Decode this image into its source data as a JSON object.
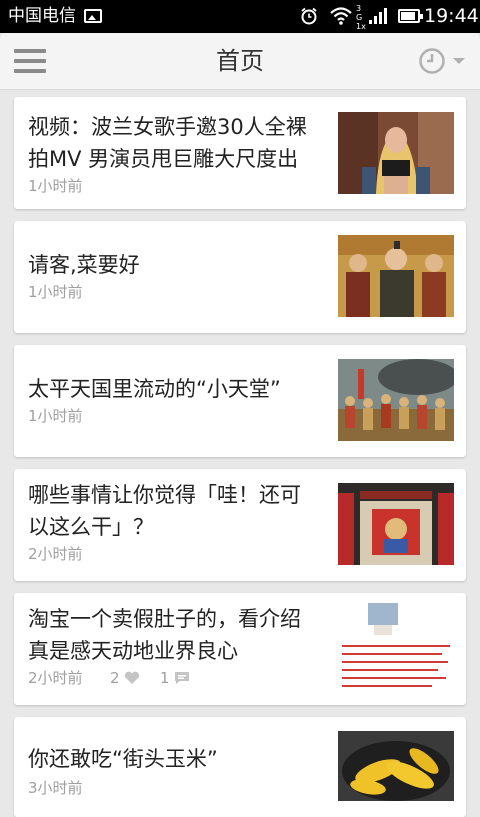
{
  "status_bar": {
    "carrier": "中国电信",
    "network_label": "3G 1x",
    "battery_level": 0.85,
    "time": "19:44"
  },
  "header": {
    "title": "首页"
  },
  "articles": [
    {
      "title_lines": [
        "视频：波兰女歌手邀30人全裸",
        "拍MV 男演员甩巨雕大尺度出"
      ],
      "time": "1小时前",
      "thumb_icon": "singer-photo"
    },
    {
      "title_lines": [
        "请客,菜要好"
      ],
      "time": "1小时前",
      "thumb_icon": "ancient-painting"
    },
    {
      "title_lines": [
        "太平天国里流动的“小天堂”"
      ],
      "time": "1小时前",
      "thumb_icon": "army-painting"
    },
    {
      "title_lines": [
        "哪些事情让你觉得「哇！还可",
        "以这么干」？"
      ],
      "time": "2小时前",
      "thumb_icon": "doorway-photo"
    },
    {
      "title_lines": [
        "淘宝一个卖假肚子的，看介绍",
        "真是感天动地业界良心"
      ],
      "time": "2小时前",
      "likes": "2",
      "comments": "1",
      "thumb_icon": "product-page"
    },
    {
      "title_lines": [
        "你还敢吃“街头玉米”"
      ],
      "time": "3小时前",
      "thumb_icon": "corn-photo"
    }
  ],
  "colors": {
    "background": "#e8e8e8",
    "card": "#ffffff",
    "meta_text": "#a0a0a0"
  }
}
